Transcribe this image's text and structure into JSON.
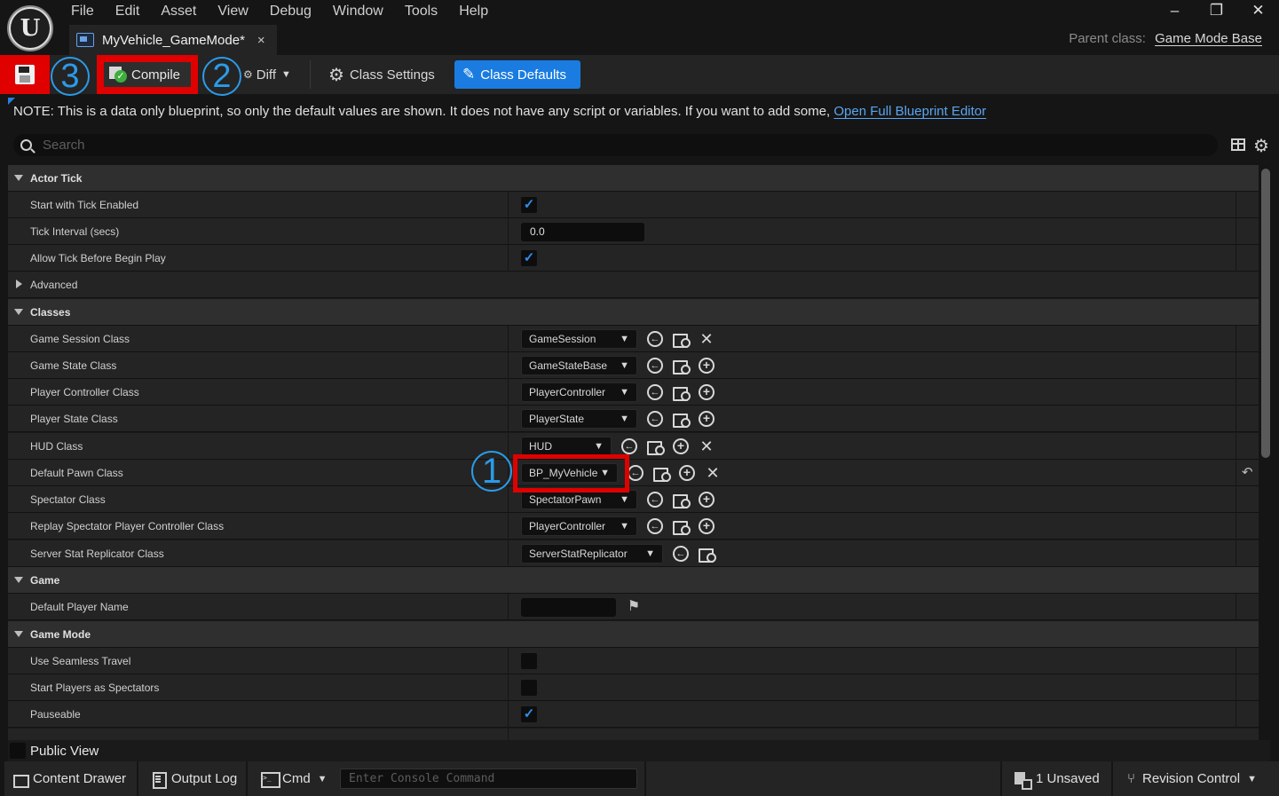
{
  "window": {
    "menu": [
      "File",
      "Edit",
      "Asset",
      "View",
      "Debug",
      "Window",
      "Tools",
      "Help"
    ],
    "tab_title": "MyVehicle_GameMode*",
    "tab_close": "×",
    "parent_class_label": "Parent class:",
    "parent_class_value": "Game Mode Base",
    "controls": {
      "minimize": "–",
      "restore": "❐",
      "close": "✕"
    }
  },
  "toolbar": {
    "compile_label": "Compile",
    "diff_label": "Diff",
    "class_settings_label": "Class Settings",
    "class_defaults_label": "Class Defaults"
  },
  "annotations": {
    "callout_1": "1",
    "callout_2": "2",
    "callout_3": "3"
  },
  "note": {
    "text": "NOTE: This is a data only blueprint, so only the default values are shown.  It does not have any script or variables.  If you want to add some,",
    "link": "Open Full Blueprint Editor"
  },
  "search": {
    "placeholder": "Search"
  },
  "details": {
    "actor_tick": {
      "title": "Actor Tick",
      "start_with_tick_enabled": {
        "label": "Start with Tick Enabled",
        "checked": true
      },
      "tick_interval": {
        "label": "Tick Interval (secs)",
        "value": "0.0"
      },
      "allow_tick_before_begin_play": {
        "label": "Allow Tick Before Begin Play",
        "checked": true
      },
      "advanced": "Advanced"
    },
    "classes": {
      "title": "Classes",
      "game_session": {
        "label": "Game Session Class",
        "value": "GameSession"
      },
      "game_state": {
        "label": "Game State Class",
        "value": "GameStateBase"
      },
      "player_controller": {
        "label": "Player Controller Class",
        "value": "PlayerController"
      },
      "player_state": {
        "label": "Player State Class",
        "value": "PlayerState"
      },
      "hud": {
        "label": "HUD Class",
        "value": "HUD"
      },
      "default_pawn": {
        "label": "Default Pawn Class",
        "value": "BP_MyVehicle"
      },
      "spectator": {
        "label": "Spectator Class",
        "value": "SpectatorPawn"
      },
      "replay_spectator": {
        "label": "Replay Spectator Player Controller Class",
        "value": "PlayerController"
      },
      "server_stat": {
        "label": "Server Stat Replicator Class",
        "value": "ServerStatReplicator"
      }
    },
    "game": {
      "title": "Game",
      "default_player_name": {
        "label": "Default Player Name",
        "value": ""
      }
    },
    "game_mode": {
      "title": "Game Mode",
      "use_seamless_travel": {
        "label": "Use Seamless Travel",
        "checked": false
      },
      "start_players_as_spectators": {
        "label": "Start Players as Spectators",
        "checked": false
      },
      "pauseable": {
        "label": "Pauseable",
        "checked": true
      }
    }
  },
  "public_view": {
    "label": "Public View"
  },
  "statusbar": {
    "content_drawer": "Content Drawer",
    "output_log": "Output Log",
    "cmd": "Cmd",
    "console_placeholder": "Enter Console Command",
    "unsaved": "1 Unsaved",
    "revision_control": "Revision Control"
  },
  "colors": {
    "accent": "#1a7ce0",
    "highlight_red": "#e00000",
    "callout_blue": "#2b9be8",
    "panel_bg": "#242424"
  },
  "icons": [
    "unreal-logo-icon",
    "blueprint-tab-icon",
    "save-icon",
    "compile-icon",
    "diff-icon",
    "gear-icon",
    "pencil-icon",
    "search-icon",
    "table-view-icon",
    "settings-icon",
    "use-selected-icon",
    "browse-icon",
    "add-icon",
    "clear-icon",
    "flag-icon",
    "reset-icon",
    "content-drawer-icon",
    "output-log-icon",
    "cmd-icon",
    "unsaved-icon",
    "branch-icon"
  ]
}
